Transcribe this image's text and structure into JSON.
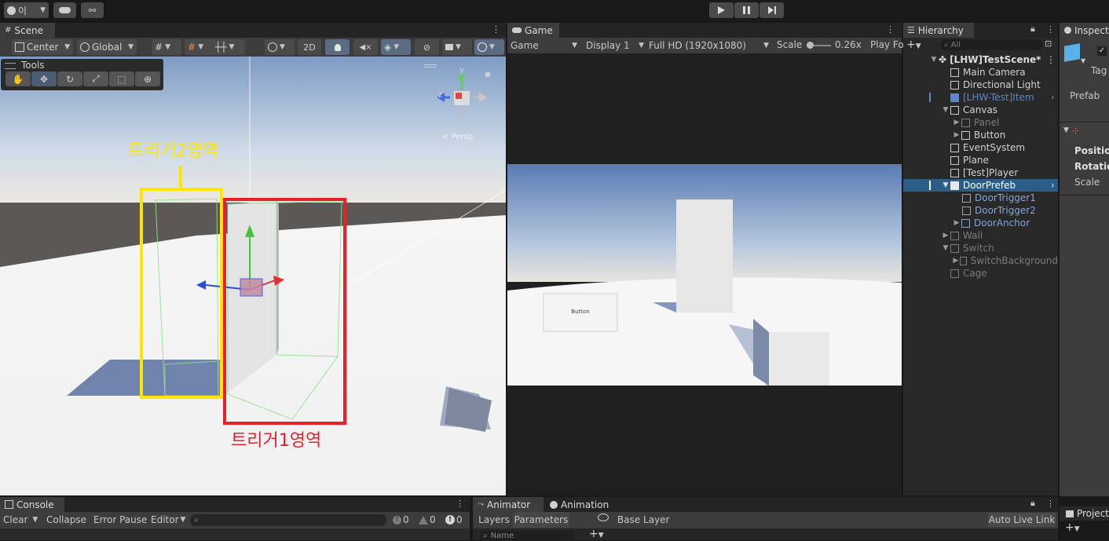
{
  "topbar": {
    "account_label": "이",
    "play_icon": "play-icon",
    "pause_icon": "pause-icon",
    "step_icon": "step-icon"
  },
  "scene": {
    "tab_label": "Scene",
    "pivot_label": "Center",
    "space_label": "Global",
    "mode_2d_label": "2D",
    "tools_label": "Tools",
    "persp_label": "< Persp",
    "annotation_trigger2": "트리거2영역",
    "annotation_trigger1": "트리거1영역",
    "gizmo_y": "y",
    "gizmo_z": "z",
    "colors": {
      "yellow": "#ffe600",
      "red": "#e8202a"
    }
  },
  "game": {
    "tab_label": "Game",
    "game_dropdown": "Game",
    "display_dropdown": "Display 1",
    "resolution_dropdown": "Full HD (1920x1080)",
    "scale_label": "Scale",
    "scale_value": "0.26x",
    "play_focused_label": "Play Fo",
    "button_label": "Button"
  },
  "hierarchy": {
    "tab_label": "Hierarchy",
    "search_placeholder": "All",
    "scene_name": "[LHW]TestScene*",
    "items": [
      {
        "label": "Main Camera"
      },
      {
        "label": "Directional Light"
      },
      {
        "label": "[LHW-Test]Item"
      },
      {
        "label": "Canvas"
      },
      {
        "label": "Panel"
      },
      {
        "label": "Button"
      },
      {
        "label": "EventSystem"
      },
      {
        "label": "Plane"
      },
      {
        "label": "[Test]Player"
      },
      {
        "label": "DoorPrefeb"
      },
      {
        "label": "DoorTrigger1"
      },
      {
        "label": "DoorTrigger2"
      },
      {
        "label": "DoorAnchor"
      },
      {
        "label": "Wall"
      },
      {
        "label": "Switch"
      },
      {
        "label": "SwitchBackground"
      },
      {
        "label": "Cage"
      }
    ]
  },
  "inspector": {
    "tab_label": "Inspect",
    "tag_label": "Tag",
    "prefab_label": "Prefab",
    "position_label": "Position",
    "rotation_label": "Rotation",
    "scale_label": "Scale",
    "project_tab_label": "Project"
  },
  "console": {
    "tab_label": "Console",
    "clear_label": "Clear",
    "collapse_label": "Collapse",
    "error_pause_label": "Error Pause",
    "editor_label": "Editor",
    "log_count": "0",
    "warn_count": "0",
    "error_count": "0"
  },
  "animator": {
    "animator_tab_label": "Animator",
    "animation_tab_label": "Animation",
    "layers_label": "Layers",
    "parameters_label": "Parameters",
    "base_layer_label": "Base Layer",
    "auto_live_link_label": "Auto Live Link",
    "name_placeholder": "Name"
  }
}
